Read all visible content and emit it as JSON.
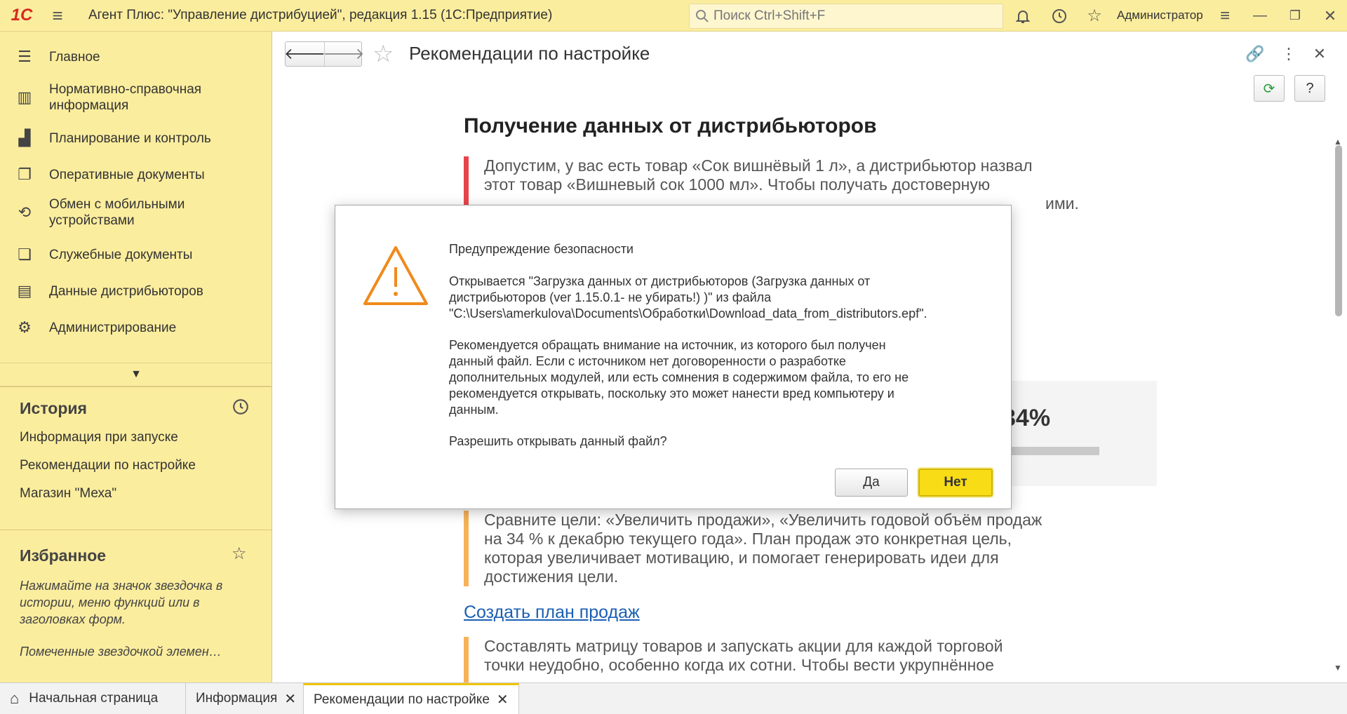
{
  "app": {
    "logo": "1С",
    "title": "Агент Плюс: \"Управление дистрибуцией\", редакция 1.15  (1С:Предприятие)",
    "search_placeholder": "Поиск Ctrl+Shift+F",
    "user": "Администратор"
  },
  "sidebar": {
    "items": [
      {
        "label": "Главное",
        "icon": "menu-icon"
      },
      {
        "label": "Нормативно-справочная информация",
        "icon": "catalog-icon"
      },
      {
        "label": "Планирование и контроль",
        "icon": "chart-icon"
      },
      {
        "label": "Оперативные документы",
        "icon": "documents-icon"
      },
      {
        "label": "Обмен с мобильными устройствами",
        "icon": "sync-icon"
      },
      {
        "label": "Служебные документы",
        "icon": "service-docs-icon"
      },
      {
        "label": "Данные дистрибьюторов",
        "icon": "distributor-data-icon"
      },
      {
        "label": "Администрирование",
        "icon": "gear-icon"
      }
    ],
    "history": {
      "title": "История",
      "items": [
        "Информация при запуске",
        "Рекомендации по настройке",
        "Магазин \"Меха\""
      ]
    },
    "favorites": {
      "title": "Избранное",
      "hint": "Нажимайте на значок звездочка в истории, меню функций или в заголовках форм.",
      "hint2": "Помеченные звездочкой элемен…"
    }
  },
  "tabs": [
    {
      "label": "Начальная страница",
      "icon": "home-icon",
      "closable": false,
      "active": false
    },
    {
      "label": "Информация",
      "closable": true,
      "active": false
    },
    {
      "label": "Рекомендации по настройке",
      "closable": true,
      "active": true
    }
  ],
  "form": {
    "title": "Рекомендации по настройке",
    "refresh_label": "⟳",
    "help_label": "?"
  },
  "content": {
    "heading": "Получение данных от дистрибьюторов",
    "p1_line1": "Допустим, у вас есть товар «Сок вишнёвый 1 л», а дистрибьютор назвал",
    "p1_line2": "этот товар «Вишневый сок 1000 мл». Чтобы получать достоверную",
    "p1_line3_tail": "ими.",
    "percent_fragment": "34%",
    "p2_line1": "Сравните цели: «Увеличить продажи», «Увеличить годовой объём продаж",
    "p2_line2": "на 34 % к декабрю текущего года». План продаж это конкретная цель,",
    "p2_line3": "которая увеличивает мотивацию, и помогает генерировать идеи для",
    "p2_line4": "достижения цели.",
    "link": "Создать план продаж",
    "p3_line1": "Составлять матрицу товаров и запускать акции для каждой торговой",
    "p3_line2": "точки неудобно, особенно когда их сотни. Чтобы вести укрупнённое"
  },
  "dialog": {
    "title": "Предупреждение безопасности",
    "para1_l1": "Открывается \"Загрузка данных от дистрибьюторов (Загрузка данных от",
    "para1_l2": "дистрибьюторов (ver 1.15.0.1- не убирать!) )\" из файла",
    "para1_l3": "\"C:\\Users\\amerkulova\\Documents\\Обработки\\Download_data_from_distributors.epf\".",
    "para2_l1": "Рекомендуется обращать внимание на источник, из которого был получен",
    "para2_l2": "данный файл. Если с источником нет договоренности о разработке",
    "para2_l3": "дополнительных модулей, или есть сомнения в содержимом файла, то его не",
    "para2_l4": "рекомендуется открывать, поскольку это может нанести вред компьютеру и",
    "para2_l5": "данным.",
    "question": "Разрешить открывать данный файл?",
    "yes_label": "Да",
    "no_label": "Нет"
  }
}
